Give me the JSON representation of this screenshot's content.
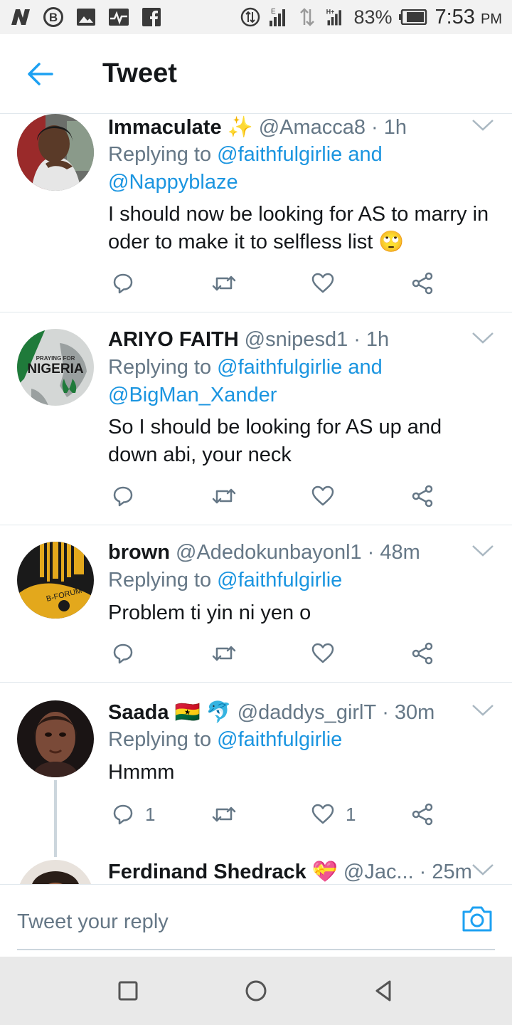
{
  "status_bar": {
    "battery": "83%",
    "time": "7:53",
    "ampm": "PM",
    "icons": [
      "n-logo-icon",
      "b-circle-icon",
      "image-icon",
      "activity-icon",
      "facebook-icon",
      "data-saver-icon",
      "signal-e-icon",
      "data-arrows-icon",
      "signal-h-plus-icon",
      "battery-icon"
    ]
  },
  "header": {
    "title": "Tweet",
    "back_icon": "arrow-left-icon"
  },
  "colors": {
    "accent": "#1da1f2",
    "mention": "#1b95e0",
    "secondary_text": "#657786",
    "divider": "#e1e8ed"
  },
  "tweets": [
    {
      "name": "Immaculate",
      "emoji": "✨",
      "handle": "@Amacca8",
      "time": "· 1h",
      "replying_label": "Replying to",
      "reply_line1": "@faithfulgirlie and",
      "reply_line2": "@Nappyblaze",
      "body": "I should now be looking for AS to marry in oder to make it to selfless list 🙄",
      "reply_count": "",
      "like_count": ""
    },
    {
      "name": "ARIYO FAITH",
      "emoji": "",
      "handle": "@snipesd1",
      "time": "· 1h",
      "replying_label": "Replying to",
      "reply_line1": "@faithfulgirlie and",
      "reply_line2": "@BigMan_Xander",
      "body": "So I should be looking for AS up and down abi, your neck",
      "avatar_text_small": "PRAYING FOR",
      "avatar_text_big": "NIGERIA",
      "reply_count": "",
      "like_count": ""
    },
    {
      "name": "brown",
      "emoji": "",
      "handle": "@Adedokunbayonl1",
      "time": "· 48m",
      "replying_label": "Replying to",
      "reply_line1": "@faithfulgirlie",
      "reply_line2": "",
      "body": "Problem ti yin ni yen o",
      "avatar_text": "B-FORUM",
      "reply_count": "",
      "like_count": ""
    },
    {
      "name": "Saada",
      "emoji": "🇬🇭 🐬",
      "handle": "@daddys_girlT",
      "time": "· 30m",
      "replying_label": "Replying to",
      "reply_line1": "@faithfulgirlie",
      "reply_line2": "",
      "body": "Hmmm",
      "reply_count": "1",
      "like_count": "1"
    },
    {
      "name": "Ferdinand Shedrack",
      "emoji": "💝",
      "handle": "@Jac...",
      "time": "· 25m"
    }
  ],
  "reply_bar": {
    "placeholder": "Tweet your reply",
    "camera_icon": "camera-icon"
  },
  "nav_bar": {
    "icons": [
      "recents-square-icon",
      "home-circle-icon",
      "back-triangle-icon"
    ]
  }
}
